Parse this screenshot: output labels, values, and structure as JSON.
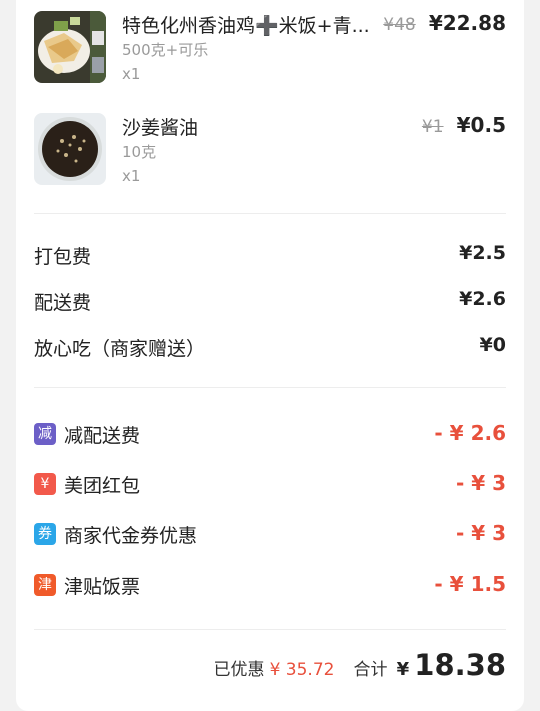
{
  "items": [
    {
      "name": "特色化州香油鸡➕米饭+青...",
      "spec": "500克+可乐",
      "qty": "x1",
      "original_price": "¥48",
      "price": "¥22.88",
      "thumb_icon": "chicken-rice-photo"
    },
    {
      "name": "沙姜酱油",
      "spec": "10克",
      "qty": "x1",
      "original_price": "¥1",
      "price": "¥0.5",
      "thumb_icon": "sauce-bowl-photo"
    }
  ],
  "fees": [
    {
      "label": "打包费",
      "value": "¥2.5"
    },
    {
      "label": "配送费",
      "value": "¥2.6"
    },
    {
      "label": "放心吃（商家赠送）",
      "value": "¥0"
    }
  ],
  "discounts": [
    {
      "badge": "减",
      "badge_color": "#6c5fc7",
      "label": "减配送费",
      "value": "- ¥ 2.6"
    },
    {
      "badge": "¥",
      "badge_color": "#f2594b",
      "label": "美团红包",
      "value": "- ¥ 3"
    },
    {
      "badge": "券",
      "badge_color": "#2ba6e8",
      "label": "商家代金券优惠",
      "value": "- ¥ 3"
    },
    {
      "badge": "津",
      "badge_color": "#f05a2a",
      "label": "津贴饭票",
      "value": "- ¥ 1.5"
    }
  ],
  "summary": {
    "saved_label": "已优惠",
    "saved_value": "¥ 35.72",
    "total_label": "合计",
    "total_currency": "¥",
    "total_value": "18.38"
  },
  "colors": {
    "accent_red": "#e8503c",
    "divider": "#ededed"
  }
}
